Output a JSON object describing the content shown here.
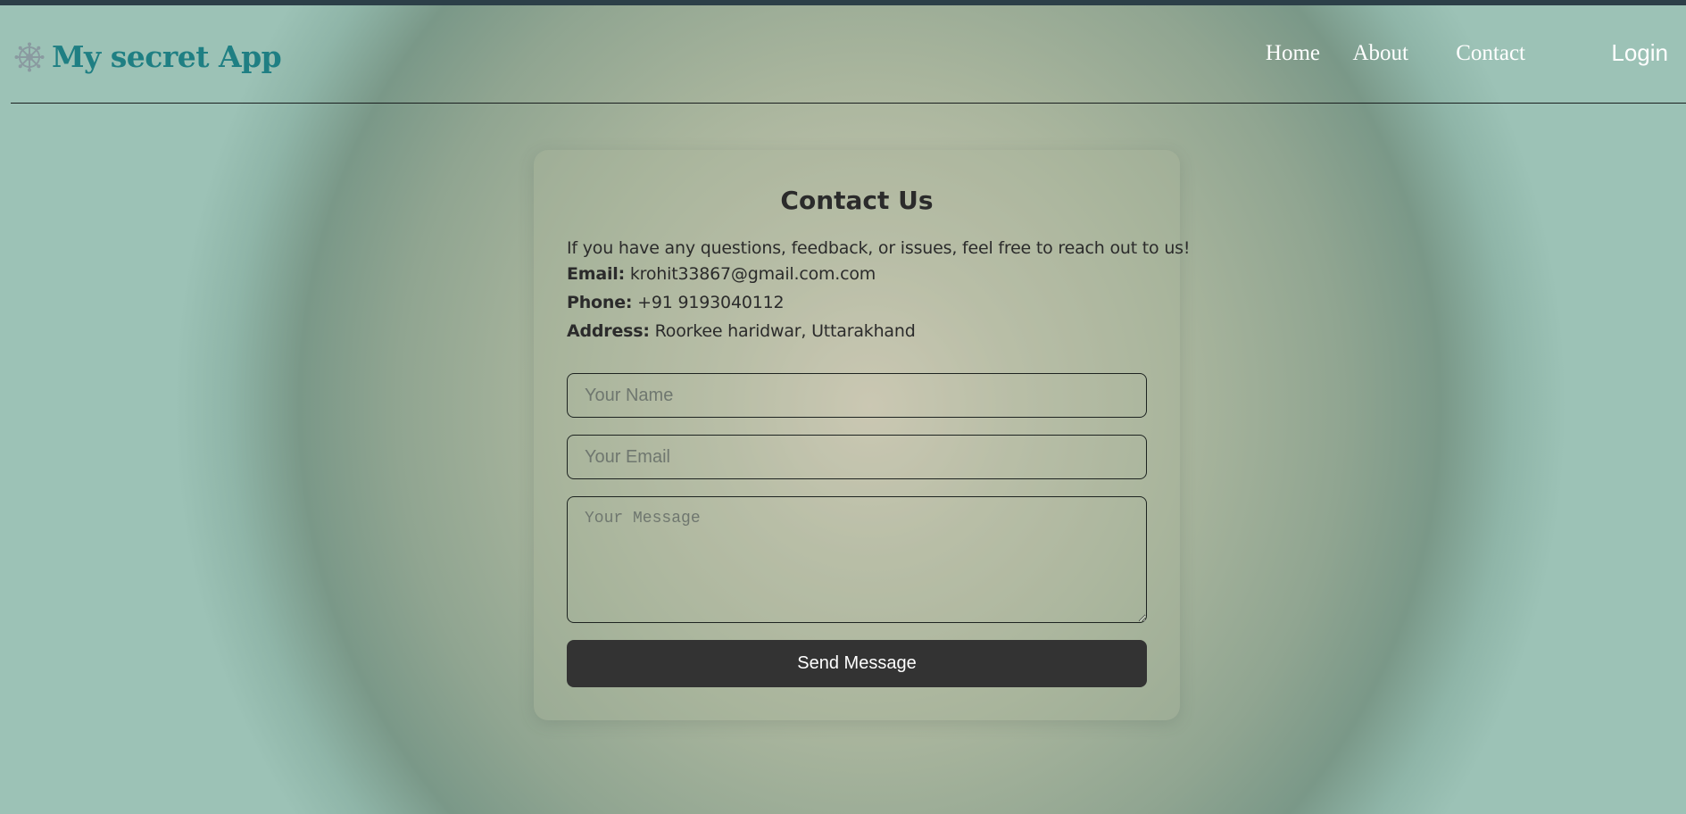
{
  "colors": {
    "brand": "#1f7f83",
    "nav_text": "#ffffff",
    "button_bg": "#333333",
    "top_bar": "#2c3f48"
  },
  "navbar": {
    "brand_icon": "dharma-wheel-icon",
    "brand_name": "My secret App",
    "links": [
      "Home",
      "About",
      "Contact"
    ],
    "login_label": "Login"
  },
  "contact": {
    "title": "Contact Us",
    "intro": "If you have any questions, feedback, or issues, feel free to reach out to us!",
    "email_label": "Email:",
    "email_value": "krohit33867@gmail.com.com",
    "phone_label": "Phone:",
    "phone_value": "+91 9193040112",
    "address_label": "Address:",
    "address_value": "Roorkee haridwar, Uttarakhand"
  },
  "form": {
    "name_placeholder": "Your Name",
    "name_value": "",
    "email_placeholder": "Your Email",
    "email_value": "",
    "message_placeholder": "Your Message",
    "message_value": "",
    "submit_label": "Send Message"
  }
}
